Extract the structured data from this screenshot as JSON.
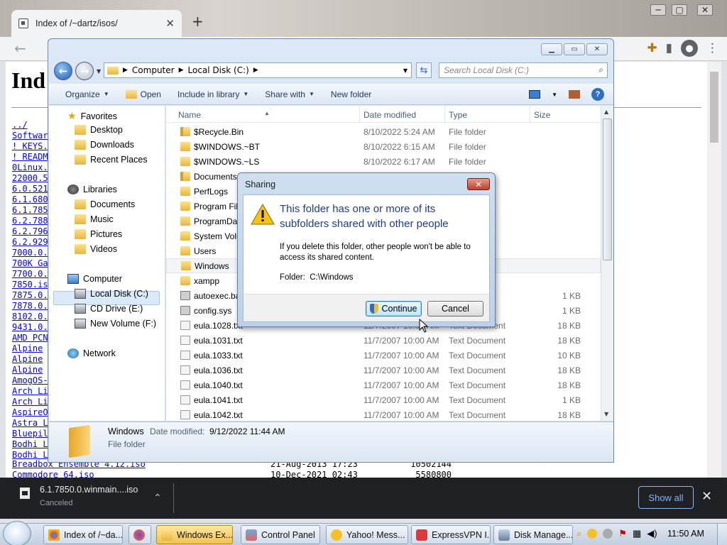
{
  "browser": {
    "tab_title": "Index of /~dartz/isos/",
    "new_tab": "+",
    "page_heading": "Ind",
    "listing": [
      "../",
      "Softwar",
      "! KEYS.",
      "! READM",
      "0Linux.",
      "22000.5",
      "6.0.521",
      "6.1.680",
      "6.1.785",
      "6.2.788",
      "6.2.796",
      "6.2.929",
      "7000.0.",
      "700K Ga",
      "7700.0.",
      "7850.is",
      "7875.0.",
      "7878.0.",
      "8102.0.",
      "9431.0.",
      "AMD PCN",
      "Alpine ",
      "Alpine ",
      "Alpine ",
      "AmogOS-",
      "Arch Li",
      "Arch Li",
      "AspireO",
      "Astra L",
      "Bluepil",
      "Bodhi L",
      "Bodhi L"
    ],
    "listing_tail": [
      {
        "name": "Breadbox Ensemble 4.12.iso",
        "date": "21-Aug-2013 17:23",
        "size": "10502144"
      },
      {
        "name": "Commodore 64.iso",
        "date": "10-Dec-2021 02:43",
        "size": "5580800"
      }
    ],
    "download": {
      "file": "6.1.7850.0.winmain....iso",
      "status": "Canceled",
      "show_all": "Show all",
      "close": "✕"
    }
  },
  "explorer": {
    "address": [
      "Computer",
      "Local Disk (C:)"
    ],
    "search_placeholder": "Search Local Disk (C:)",
    "toolbar": {
      "organize": "Organize",
      "open": "Open",
      "include": "Include in library",
      "share": "Share with",
      "new_folder": "New folder"
    },
    "nav": {
      "favorites": "Favorites",
      "desktop": "Desktop",
      "downloads": "Downloads",
      "recent": "Recent Places",
      "libraries": "Libraries",
      "documents": "Documents",
      "music": "Music",
      "pictures": "Pictures",
      "videos": "Videos",
      "computer": "Computer",
      "local_disk": "Local Disk (C:)",
      "cd_drive": "CD Drive (E:)",
      "new_volume": "New Volume (F:)",
      "network": "Network"
    },
    "columns": {
      "name": "Name",
      "date": "Date modified",
      "type": "Type",
      "size": "Size"
    },
    "files": [
      {
        "name": "$Recycle.Bin",
        "date": "8/10/2022 5:24 AM",
        "type": "File folder",
        "size": ""
      },
      {
        "name": "$WINDOWS.~BT",
        "date": "8/10/2022 6:15 AM",
        "type": "File folder",
        "size": ""
      },
      {
        "name": "$WINDOWS.~LS",
        "date": "8/10/2022 6:17 AM",
        "type": "File folder",
        "size": ""
      },
      {
        "name": "Documents",
        "date": "",
        "type": "",
        "size": ""
      },
      {
        "name": "PerfLogs",
        "date": "",
        "type": "",
        "size": ""
      },
      {
        "name": "Program Fil",
        "date": "",
        "type": "",
        "size": ""
      },
      {
        "name": "ProgramDat",
        "date": "",
        "type": "",
        "size": ""
      },
      {
        "name": "System Volu",
        "date": "",
        "type": "",
        "size": ""
      },
      {
        "name": "Users",
        "date": "",
        "type": "",
        "size": ""
      },
      {
        "name": "Windows",
        "date": "",
        "type": "",
        "size": ""
      },
      {
        "name": "xampp",
        "date": "",
        "type": "",
        "size": ""
      },
      {
        "name": "autoexec.ba",
        "date": "",
        "type": "tch File",
        "size": "1 KB"
      },
      {
        "name": "config.sys",
        "date": "",
        "type": "",
        "size": "1 KB"
      },
      {
        "name": "eula.1028.txt",
        "date": "11/7/2007 10:00 AM",
        "type": "Text Document",
        "size": "18 KB"
      },
      {
        "name": "eula.1031.txt",
        "date": "11/7/2007 10:00 AM",
        "type": "Text Document",
        "size": "18 KB"
      },
      {
        "name": "eula.1033.txt",
        "date": "11/7/2007 10:00 AM",
        "type": "Text Document",
        "size": "10 KB"
      },
      {
        "name": "eula.1036.txt",
        "date": "11/7/2007 10:00 AM",
        "type": "Text Document",
        "size": "18 KB"
      },
      {
        "name": "eula.1040.txt",
        "date": "11/7/2007 10:00 AM",
        "type": "Text Document",
        "size": "18 KB"
      },
      {
        "name": "eula.1041.txt",
        "date": "11/7/2007 10:00 AM",
        "type": "Text Document",
        "size": "1 KB"
      },
      {
        "name": "eula.1042.txt",
        "date": "11/7/2007 10:00 AM",
        "type": "Text Document",
        "size": "18 KB"
      }
    ],
    "details": {
      "name": "Windows",
      "date_label": "Date modified:",
      "date": "9/12/2022 11:44 AM",
      "type": "File folder"
    }
  },
  "dialog": {
    "title": "Sharing",
    "heading": "This folder has one or more of its subfolders shared with other people",
    "text": "If you delete this folder, other people won't be able to access its shared content.",
    "folder_label": "Folder:",
    "folder_path": "C:\\Windows",
    "continue": "Continue",
    "cancel": "Cancel",
    "close": "✕"
  },
  "taskbar": {
    "items": [
      "Index of /~da...",
      "Windows Ex...",
      "Control Panel",
      "Yahoo! Mess...",
      "ExpressVPN I...",
      "Disk Manage..."
    ],
    "clock": "11:50 AM"
  }
}
